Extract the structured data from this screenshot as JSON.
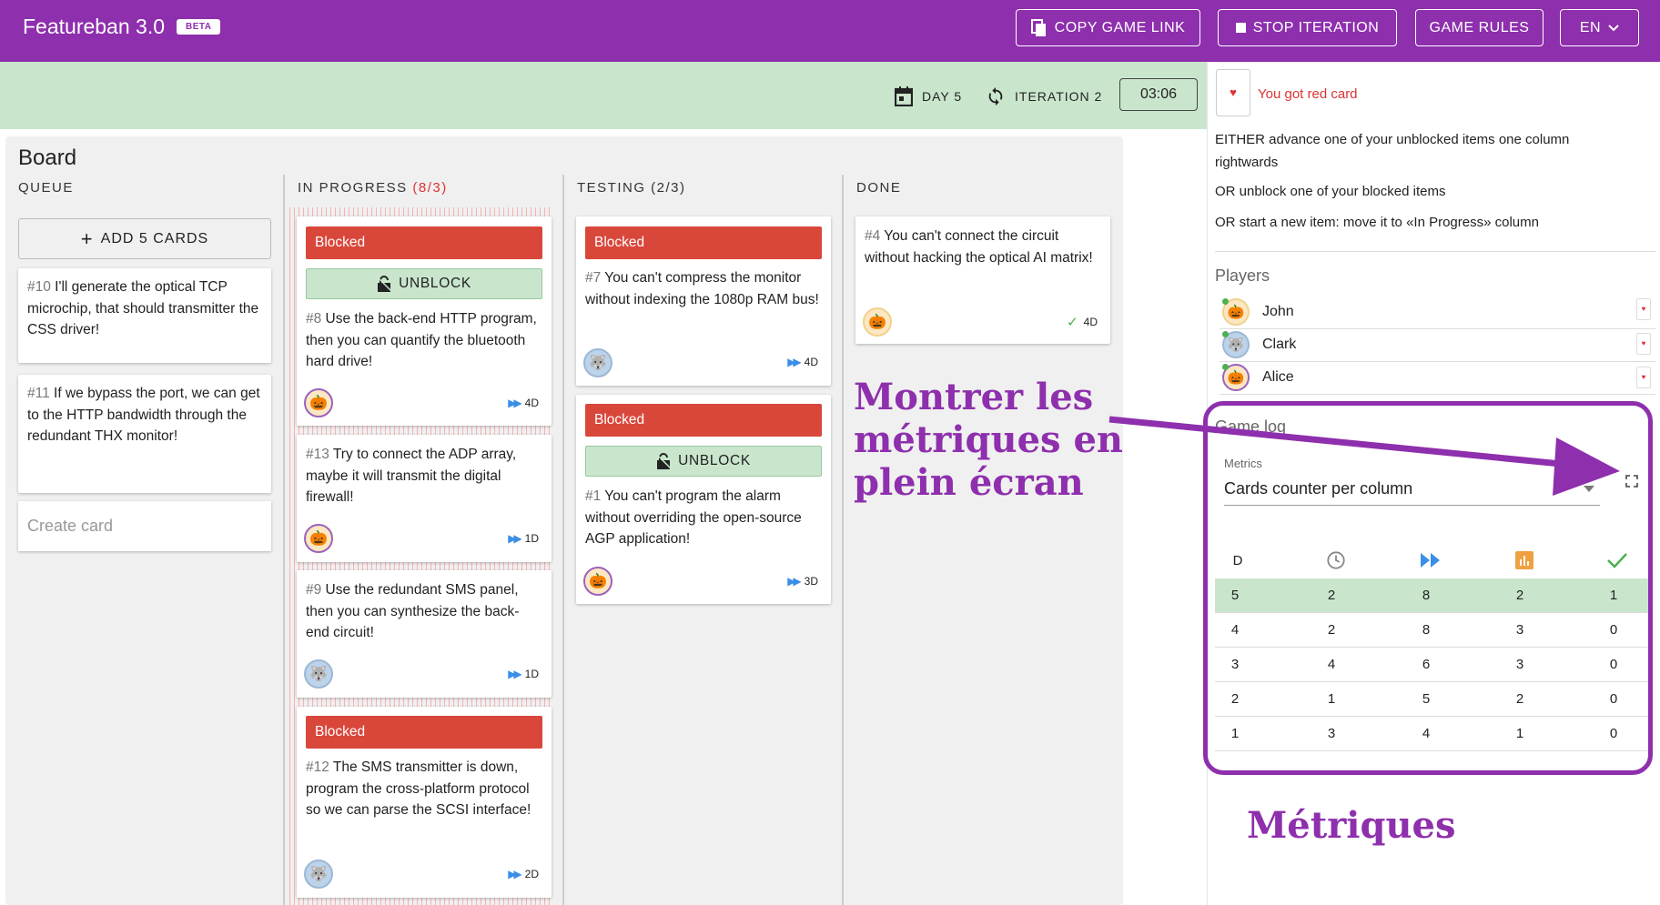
{
  "header": {
    "app_title": "Featureban 3.0",
    "beta_badge": "BETA",
    "copy_link_label": "COPY GAME LINK",
    "stop_iteration_label": "STOP ITERATION",
    "game_rules_label": "GAME RULES",
    "language_label": "EN"
  },
  "status": {
    "day_label": "DAY 5",
    "iteration_label": "ITERATION 2",
    "timer": "03:06"
  },
  "board": {
    "title": "Board",
    "columns": {
      "queue": {
        "label": "QUEUE"
      },
      "in_progress": {
        "label": "IN PROGRESS",
        "limit": "(8/3)"
      },
      "testing": {
        "label": "TESTING (2/3)"
      },
      "done": {
        "label": "DONE"
      }
    },
    "add_cards_label": "ADD 5 CARDS",
    "create_card_placeholder": "Create card",
    "blocked_label": "Blocked",
    "unblock_label": "UNBLOCK",
    "cards": {
      "c10": {
        "num": "#10",
        "text": " I'll generate the optical TCP microchip, that should transmitter the CSS driver!"
      },
      "c11": {
        "num": "#11",
        "text": " If we bypass the port, we can get to the HTTP bandwidth through the redundant THX monitor!"
      },
      "c8": {
        "num": "#8",
        "text": " Use the back-end HTTP program, then you can quantify the bluetooth hard drive!",
        "estimate": "4D"
      },
      "c13": {
        "num": "#13",
        "text": " Try to connect the ADP array, maybe it will transmit the digital firewall!",
        "estimate": "1D"
      },
      "c9": {
        "num": "#9",
        "text": " Use the redundant SMS panel, then you can synthesize the back-end circuit!",
        "estimate": "1D"
      },
      "c12": {
        "num": "#12",
        "text": " The SMS transmitter is down, program the cross-platform protocol so we can parse the SCSI interface!",
        "estimate": "2D"
      },
      "c7": {
        "num": "#7",
        "text": " You can't compress the monitor without indexing the 1080p RAM bus!",
        "estimate": "4D"
      },
      "c1": {
        "num": "#1",
        "text": " You can't program the alarm without overriding the open-source AGP application!",
        "estimate": "3D"
      },
      "c4": {
        "num": "#4",
        "text": " You can't connect the circuit without hacking the optical AI matrix!",
        "estimate": "4D"
      }
    }
  },
  "right_panel": {
    "card_message": "You got red card",
    "rule_1": "EITHER advance one of your unblocked items one column rightwards",
    "rule_2": "OR unblock one of your blocked items",
    "rule_3": "OR start a new item: move it to «In Progress» column",
    "players_title": "Players",
    "players": [
      {
        "name": "John",
        "avatar": "pumpkin-icon"
      },
      {
        "name": "Clark",
        "avatar": "wolf-icon"
      },
      {
        "name": "Alice",
        "avatar": "pumpkin-icon"
      }
    ],
    "game_log_title": "Game log",
    "metrics_label": "Metrics",
    "metrics_value": "Cards counter per column",
    "table": {
      "day_header": "D",
      "columns_icons": [
        "clock-icon",
        "fast-forward-icon",
        "bar-chart-icon",
        "check-icon"
      ],
      "rows": [
        [
          "5",
          "2",
          "8",
          "2",
          "1"
        ],
        [
          "4",
          "2",
          "8",
          "3",
          "0"
        ],
        [
          "3",
          "4",
          "6",
          "3",
          "0"
        ],
        [
          "2",
          "1",
          "5",
          "2",
          "0"
        ],
        [
          "1",
          "3",
          "4",
          "1",
          "0"
        ]
      ]
    }
  },
  "annotations": {
    "fullscreen_note_line1": "Montrer les",
    "fullscreen_note_line2": "métriques en",
    "fullscreen_note_line3": "plein écran",
    "metrics_note": "Métriques"
  },
  "colors": {
    "brand": "#8e2fad",
    "status_bar": "#c9e6cc",
    "blocked": "#d9473b",
    "annotation": "#8e2fad"
  }
}
